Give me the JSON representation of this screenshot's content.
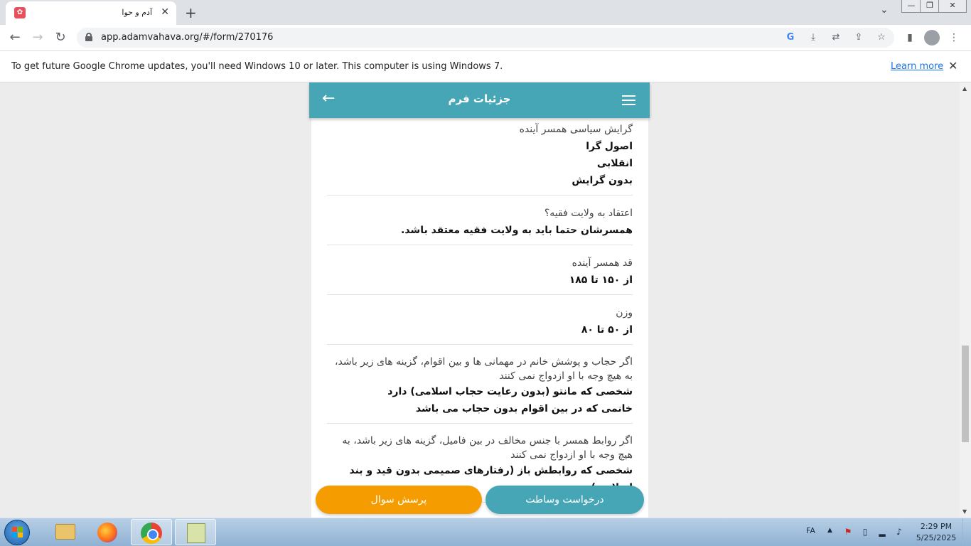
{
  "browser": {
    "tab": {
      "title": "آدم و حوا",
      "close": "✕"
    },
    "new_tab": "+",
    "tab_menu": "⌄",
    "window_controls": {
      "minimize": "—",
      "restore": "❐",
      "close": "✕"
    },
    "url": "app.adamvahava.org/#/form/270176",
    "infobar": {
      "message": "To get future Google Chrome updates, you'll need Windows 10 or later. This computer is using Windows 7.",
      "link": "Learn more",
      "close": "✕"
    }
  },
  "page": {
    "title": "جزئیات فرم",
    "fields": [
      {
        "label": "گرایش سیاسی همسر آینده",
        "values": [
          "اصول گرا",
          "انقلابی",
          "بدون گرایش"
        ]
      },
      {
        "label": "اعتقاد به ولایت فقیه؟",
        "values": [
          "همسرشان حتما باید به ولایت فقیه معتقد باشد."
        ]
      },
      {
        "label": "قد همسر آینده",
        "values": [
          "از ۱۵۰ تا ۱۸۵"
        ]
      },
      {
        "label": "وزن",
        "values": [
          "از ۵۰ تا ۸۰"
        ]
      },
      {
        "label": "اگر حجاب و پوشش خانم در مهمانی ها و بین اقوام، گزینه های زیر باشد، به هیچ وجه با او ازدواج نمی کنند",
        "values": [
          "شخصی که مانتو (بدون رعایت حجاب اسلامی) دارد",
          "خانمی که در بین اقوام بدون حجاب می باشد"
        ]
      },
      {
        "label": "اگر روابط همسر با جنس مخالف در بین فامیل، گزینه های زیر باشد، به هیچ وجه با او ازدواج نمی کنند",
        "values": [
          "شخصی که روابطش باز (رفتارهای صمیمی بدون قید و بند اسلامی) می"
        ]
      }
    ],
    "buttons": {
      "mediation": "درخواست وساطت",
      "ask_question": "پرسش سوال"
    }
  },
  "taskbar": {
    "language": "FA",
    "time": "2:29 PM",
    "date": "5/25/2025"
  },
  "colors": {
    "appbar": "#47a6b6",
    "ask_button": "#f59c00",
    "mediation_button": "#47a6b6"
  }
}
